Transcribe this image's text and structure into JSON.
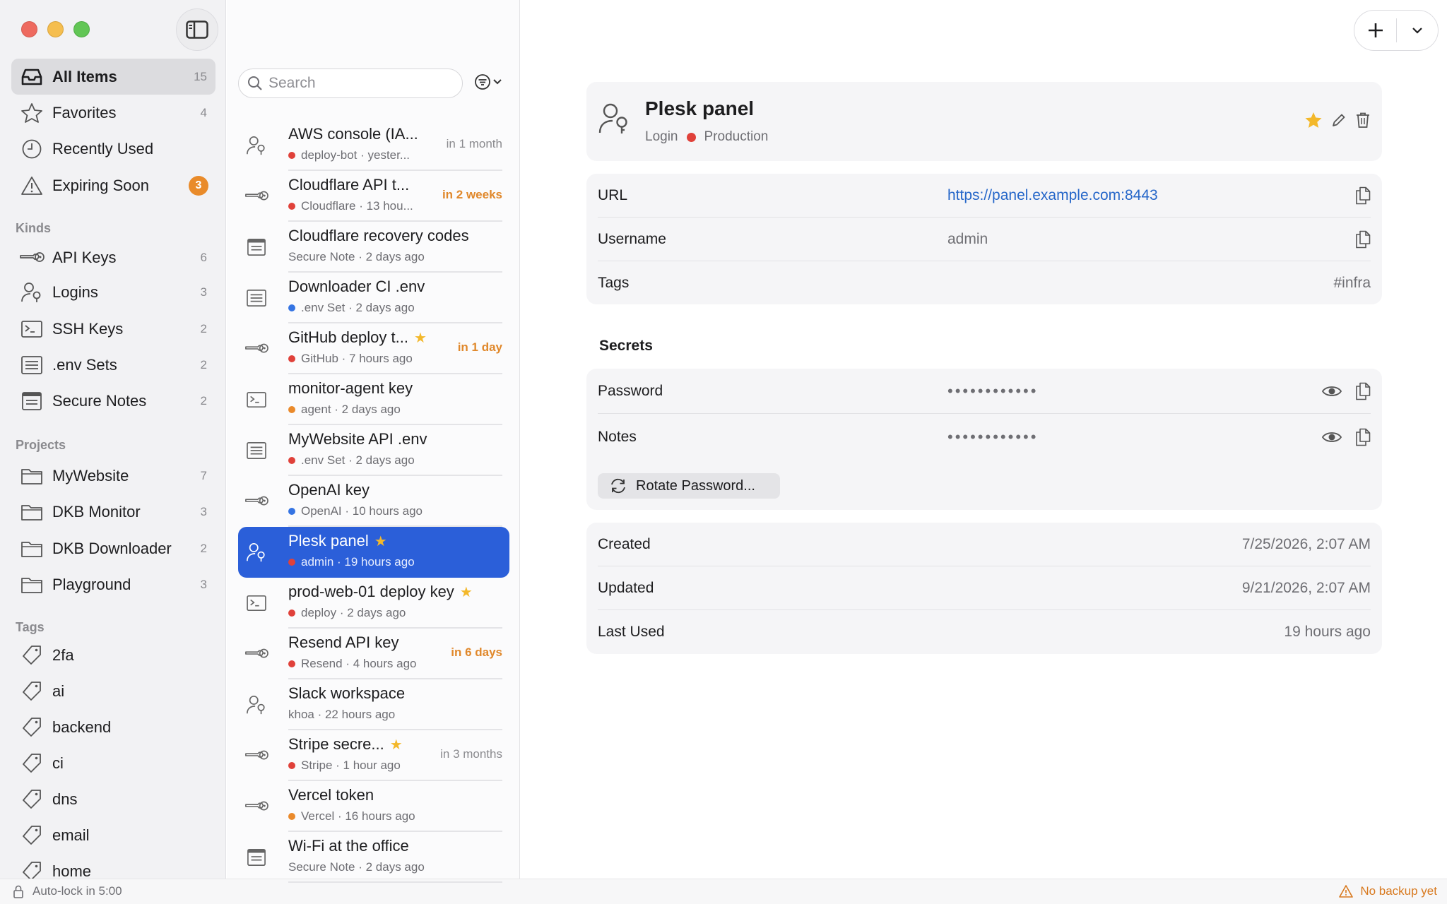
{
  "sidebar": {
    "main": [
      {
        "label": "All Items",
        "count": "15",
        "icon": "tray-icon"
      },
      {
        "label": "Favorites",
        "count": "4",
        "icon": "star-icon"
      },
      {
        "label": "Recently Used",
        "count": "",
        "icon": "clock-icon"
      },
      {
        "label": "Expiring Soon",
        "badge": "3",
        "icon": "warning-icon"
      }
    ],
    "kinds_title": "Kinds",
    "kinds": [
      {
        "label": "API Keys",
        "count": "6",
        "icon": "key-icon"
      },
      {
        "label": "Logins",
        "count": "3",
        "icon": "person-key-icon"
      },
      {
        "label": "SSH Keys",
        "count": "2",
        "icon": "terminal-icon"
      },
      {
        "label": ".env Sets",
        "count": "2",
        "icon": "list-doc-icon"
      },
      {
        "label": "Secure Notes",
        "count": "2",
        "icon": "note-icon"
      }
    ],
    "projects_title": "Projects",
    "projects": [
      {
        "label": "MyWebsite",
        "count": "7",
        "icon": "folder-icon"
      },
      {
        "label": "DKB Monitor",
        "count": "3",
        "icon": "folder-icon"
      },
      {
        "label": "DKB Downloader",
        "count": "2",
        "icon": "folder-icon"
      },
      {
        "label": "Playground",
        "count": "3",
        "icon": "folder-icon"
      }
    ],
    "tags_title": "Tags",
    "tags": [
      {
        "label": "2fa",
        "icon": "tag-icon"
      },
      {
        "label": "ai",
        "icon": "tag-icon"
      },
      {
        "label": "backend",
        "icon": "tag-icon"
      },
      {
        "label": "ci",
        "icon": "tag-icon"
      },
      {
        "label": "dns",
        "icon": "tag-icon"
      },
      {
        "label": "email",
        "icon": "tag-icon"
      },
      {
        "label": "home",
        "icon": "tag-icon"
      }
    ]
  },
  "status": {
    "autolock": "Auto-lock in 5:00",
    "backup": "No backup yet"
  },
  "search": {
    "placeholder": "Search"
  },
  "items": [
    {
      "title": "AWS console (IA...",
      "sub": "deploy-bot · yester...",
      "dot": "#e0413a",
      "expiry": "in 1 month",
      "expiry_style": "norm",
      "star": false,
      "icon": "login"
    },
    {
      "title": "Cloudflare API t...",
      "sub": "Cloudflare · 13 hou...",
      "dot": "#e0413a",
      "expiry": "in 2 weeks",
      "expiry_style": "warn",
      "star": false,
      "icon": "key"
    },
    {
      "title": "Cloudflare recovery codes",
      "sub": "Secure Note · 2 days ago",
      "dot": "",
      "expiry": "",
      "expiry_style": "norm",
      "star": false,
      "icon": "note"
    },
    {
      "title": "Downloader CI .env",
      "sub": ".env Set · 2 days ago",
      "dot": "#3574e3",
      "expiry": "",
      "expiry_style": "norm",
      "star": false,
      "icon": "env"
    },
    {
      "title": "GitHub deploy t...",
      "sub": "GitHub · 7 hours ago",
      "dot": "#e0413a",
      "expiry": "in 1 day",
      "expiry_style": "warn",
      "star": true,
      "icon": "key"
    },
    {
      "title": "monitor-agent key",
      "sub": "agent · 2 days ago",
      "dot": "#ea8a2b",
      "expiry": "",
      "expiry_style": "norm",
      "star": false,
      "icon": "ssh"
    },
    {
      "title": "MyWebsite API .env",
      "sub": ".env Set · 2 days ago",
      "dot": "#e0413a",
      "expiry": "",
      "expiry_style": "norm",
      "star": false,
      "icon": "env"
    },
    {
      "title": "OpenAI key",
      "sub": "OpenAI · 10 hours ago",
      "dot": "#3574e3",
      "expiry": "",
      "expiry_style": "norm",
      "star": false,
      "icon": "key"
    },
    {
      "title": "Plesk panel",
      "sub": "admin · 19 hours ago",
      "dot": "#e0413a",
      "expiry": "",
      "expiry_style": "norm",
      "star": true,
      "icon": "login",
      "selected": true
    },
    {
      "title": "prod-web-01 deploy key",
      "sub": "deploy · 2 days ago",
      "dot": "#e0413a",
      "expiry": "",
      "expiry_style": "norm",
      "star": true,
      "icon": "ssh"
    },
    {
      "title": "Resend API key",
      "sub": "Resend · 4 hours ago",
      "dot": "#e0413a",
      "expiry": "in 6 days",
      "expiry_style": "warn",
      "star": false,
      "icon": "key"
    },
    {
      "title": "Slack workspace",
      "sub": "khoa · 22 hours ago",
      "dot": "",
      "expiry": "",
      "expiry_style": "norm",
      "star": false,
      "icon": "login"
    },
    {
      "title": "Stripe secre...",
      "sub": "Stripe · 1 hour ago",
      "dot": "#e0413a",
      "expiry": "in 3 months",
      "expiry_style": "norm",
      "star": true,
      "icon": "key"
    },
    {
      "title": "Vercel token",
      "sub": "Vercel · 16 hours ago",
      "dot": "#ea8a2b",
      "expiry": "",
      "expiry_style": "norm",
      "star": false,
      "icon": "key"
    },
    {
      "title": "Wi-Fi at the office",
      "sub": "Secure Note · 2 days ago",
      "dot": "",
      "expiry": "",
      "expiry_style": "norm",
      "star": false,
      "icon": "note"
    }
  ],
  "detail": {
    "title": "Plesk panel",
    "kind": "Login",
    "project": "Production",
    "project_dot": "#e0413a",
    "url_label": "URL",
    "url": "https://panel.example.com:8443",
    "username_label": "Username",
    "username": "admin",
    "tags_label": "Tags",
    "tags": "#infra",
    "secrets_title": "Secrets",
    "password_label": "Password",
    "password_mask": "••••••••••••",
    "notes_label": "Notes",
    "notes_mask": "••••••••••••",
    "rotate_label": "Rotate Password...",
    "created_label": "Created",
    "created": "7/25/2026, 2:07 AM",
    "updated_label": "Updated",
    "updated": "9/21/2026, 2:07 AM",
    "last_used_label": "Last Used",
    "last_used": "19 hours ago"
  }
}
